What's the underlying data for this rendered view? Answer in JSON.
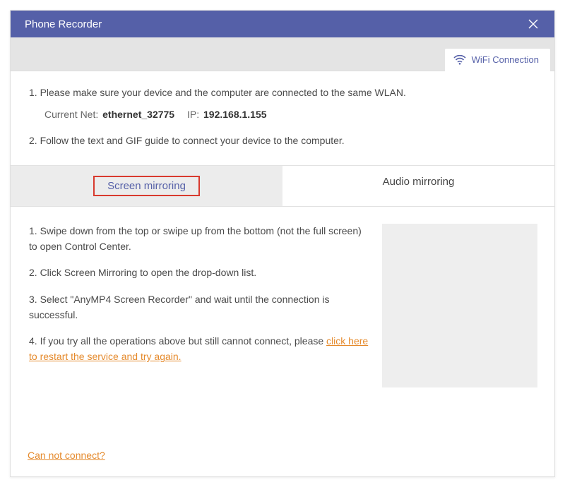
{
  "title": "Phone Recorder",
  "wifi_tab_label": "WiFi Connection",
  "step1": "1. Please make sure your device and the computer are connected to the same WLAN.",
  "net_label": "Current Net:",
  "net_value": "ethernet_32775",
  "ip_label": "IP:",
  "ip_value": "192.168.1.155",
  "step2": "2. Follow the text and GIF guide to connect your device to the computer.",
  "tabs": {
    "screen": "Screen mirroring",
    "audio": "Audio mirroring"
  },
  "instructions": {
    "i1": "1. Swipe down from the top or swipe up from the bottom (not the full screen) to open Control Center.",
    "i2": "2. Click Screen Mirroring to open the drop-down list.",
    "i3": "3. Select \"AnyMP4 Screen Recorder\" and wait until the connection is successful.",
    "i4_pre": "4. If you try all the operations above but still cannot connect, please ",
    "i4_link": "click here to restart the service and try again."
  },
  "footer_link": "Can not connect?"
}
